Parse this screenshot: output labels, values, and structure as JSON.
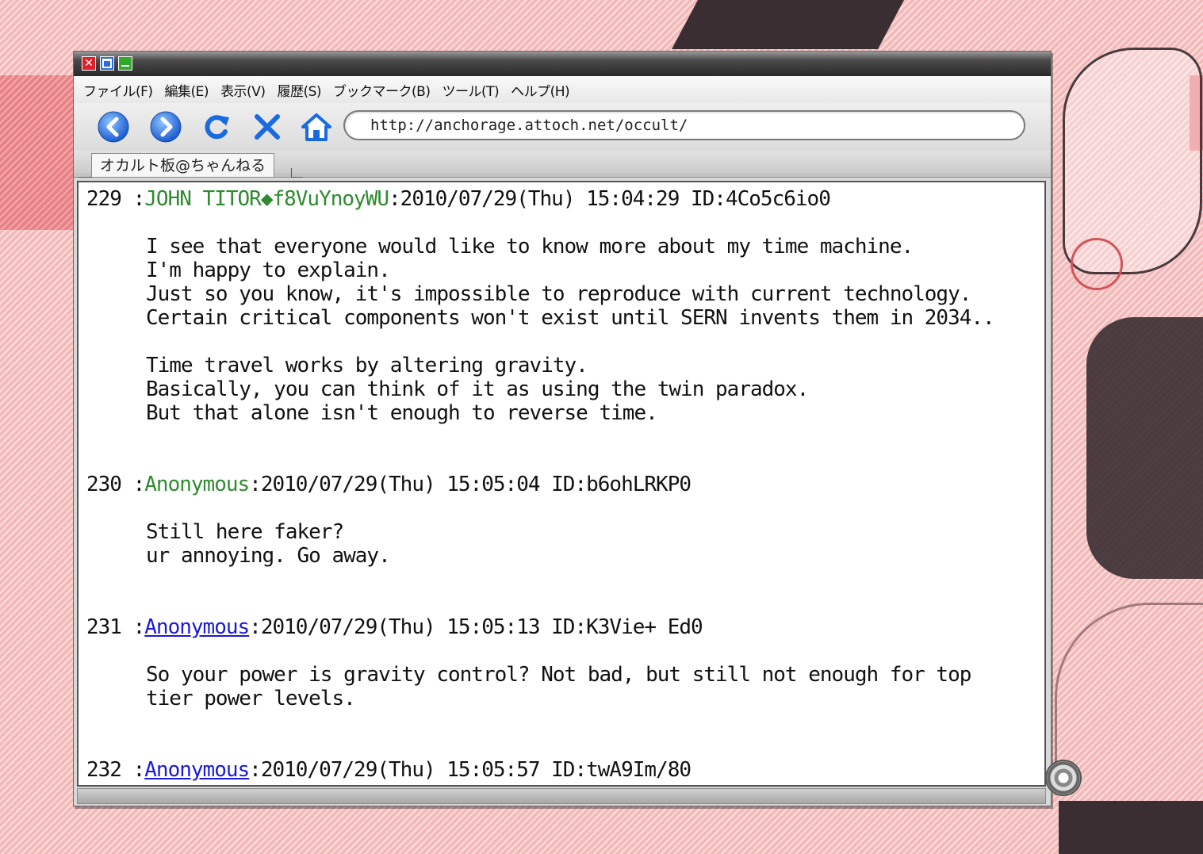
{
  "window": {
    "menu": [
      "ファイル(F)",
      "編集(E)",
      "表示(V)",
      "履歴(S)",
      "ブックマーク(B)",
      "ツール(T)",
      "ヘルプ(H)"
    ],
    "url": "http://anchorage.attoch.net/occult/",
    "tab_title": "オカルト板@ちゃんねる"
  },
  "icons": {
    "close": "close-icon",
    "maximize": "maximize-icon",
    "minimize": "minimize-icon",
    "back": "back-arrow-icon",
    "forward": "forward-arrow-icon",
    "reload": "reload-icon",
    "stop": "stop-icon",
    "home": "home-icon",
    "gear": "gear-icon"
  },
  "colors": {
    "name_green": "#2e8b2e",
    "name_link": "#1a1ad8",
    "close_button": "#e0202a",
    "maximize_button": "#2a6ae0",
    "minimize_button": "#2faa2a",
    "nav_blue": "#2a7ae0"
  },
  "posts": [
    {
      "number": "229",
      "sep": " :",
      "name": "JOHN TITOR◆f8VuYnoyWU",
      "meta": ":2010/07/29(Thu) 15:04:29 ID:4Co5c6io0",
      "body": "I see that everyone would like to know more about my time machine.\nI'm happy to explain.\nJust so you know, it's impossible to reproduce with current technology.\nCertain critical components won't exist until SERN invents them in 2034..\n\nTime travel works by altering gravity.\nBasically, you can think of it as using the twin paradox.\nBut that alone isn't enough to reverse time."
    },
    {
      "number": "230",
      "sep": " :",
      "name": "Anonymous",
      "meta": ":2010/07/29(Thu) 15:05:04 ID:b6ohLRKP0",
      "body": "Still here faker?\nur annoying. Go away."
    },
    {
      "number": "231",
      "sep": " :",
      "name": "Anonymous",
      "meta": ":2010/07/29(Thu) 15:05:13 ID:K3Vie+ Ed0",
      "body": "So your power is gravity control? Not bad, but still not enough for top\ntier power levels."
    },
    {
      "number": "232",
      "sep": " :",
      "name": "Anonymous",
      "meta": ":2010/07/29(Thu) 15:05:57 ID:twA9Im/80",
      "body": ""
    }
  ]
}
